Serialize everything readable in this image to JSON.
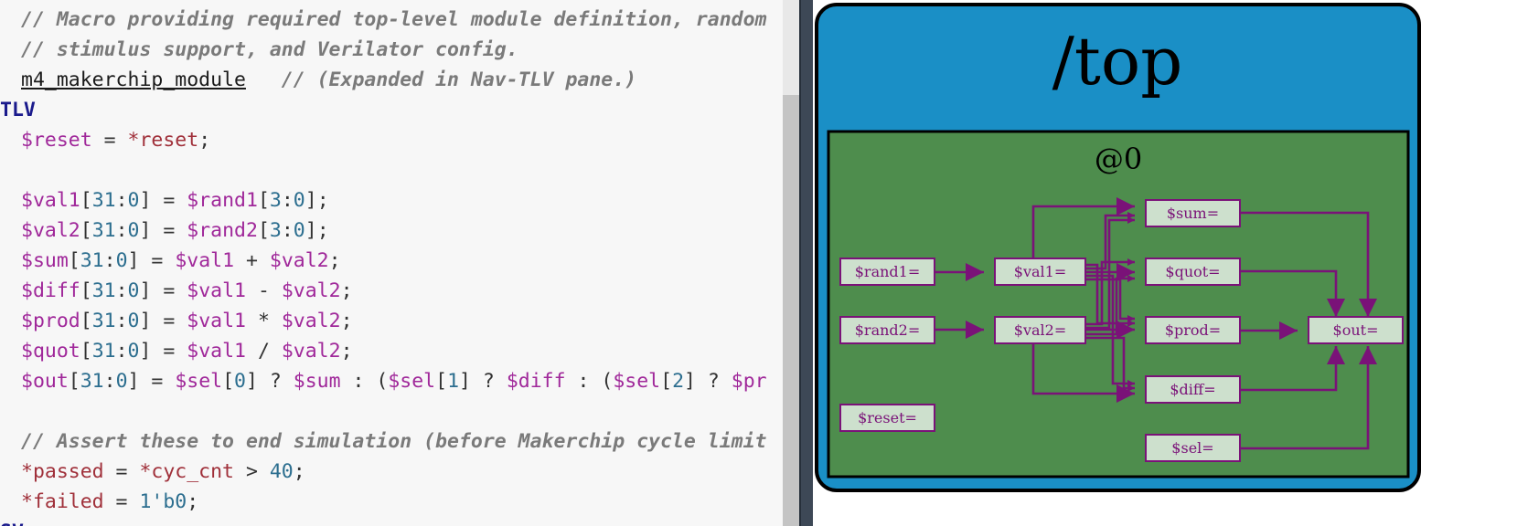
{
  "editor": {
    "lines": [
      [
        {
          "t": "// Macro providing required top-level module definition, random",
          "c": "cmt"
        }
      ],
      [
        {
          "t": "// stimulus support, and Verilator config.",
          "c": "cmt"
        }
      ],
      [
        {
          "t": "m4_makerchip_module",
          "c": "lnk"
        },
        {
          "t": "   ",
          "c": "op"
        },
        {
          "t": "// (Expanded in Nav-TLV pane.)",
          "c": "cmt"
        }
      ],
      [
        {
          "t": "\\TLV",
          "c": "kw"
        }
      ],
      [
        {
          "t": "$reset",
          "c": "sig"
        },
        {
          "t": " = ",
          "c": "op"
        },
        {
          "t": "*reset",
          "c": "tb"
        },
        {
          "t": ";",
          "c": "op"
        }
      ],
      [],
      [
        {
          "t": "$val1",
          "c": "sig"
        },
        {
          "t": "[",
          "c": "op"
        },
        {
          "t": "31",
          "c": "num"
        },
        {
          "t": ":",
          "c": "op"
        },
        {
          "t": "0",
          "c": "num"
        },
        {
          "t": "] = ",
          "c": "op"
        },
        {
          "t": "$rand1",
          "c": "sig"
        },
        {
          "t": "[",
          "c": "op"
        },
        {
          "t": "3",
          "c": "num"
        },
        {
          "t": ":",
          "c": "op"
        },
        {
          "t": "0",
          "c": "num"
        },
        {
          "t": "];",
          "c": "op"
        }
      ],
      [
        {
          "t": "$val2",
          "c": "sig"
        },
        {
          "t": "[",
          "c": "op"
        },
        {
          "t": "31",
          "c": "num"
        },
        {
          "t": ":",
          "c": "op"
        },
        {
          "t": "0",
          "c": "num"
        },
        {
          "t": "] = ",
          "c": "op"
        },
        {
          "t": "$rand2",
          "c": "sig"
        },
        {
          "t": "[",
          "c": "op"
        },
        {
          "t": "3",
          "c": "num"
        },
        {
          "t": ":",
          "c": "op"
        },
        {
          "t": "0",
          "c": "num"
        },
        {
          "t": "];",
          "c": "op"
        }
      ],
      [
        {
          "t": "$sum",
          "c": "sig"
        },
        {
          "t": "[",
          "c": "op"
        },
        {
          "t": "31",
          "c": "num"
        },
        {
          "t": ":",
          "c": "op"
        },
        {
          "t": "0",
          "c": "num"
        },
        {
          "t": "] = ",
          "c": "op"
        },
        {
          "t": "$val1",
          "c": "sig"
        },
        {
          "t": " + ",
          "c": "op"
        },
        {
          "t": "$val2",
          "c": "sig"
        },
        {
          "t": ";",
          "c": "op"
        }
      ],
      [
        {
          "t": "$diff",
          "c": "sig"
        },
        {
          "t": "[",
          "c": "op"
        },
        {
          "t": "31",
          "c": "num"
        },
        {
          "t": ":",
          "c": "op"
        },
        {
          "t": "0",
          "c": "num"
        },
        {
          "t": "] = ",
          "c": "op"
        },
        {
          "t": "$val1",
          "c": "sig"
        },
        {
          "t": " - ",
          "c": "op"
        },
        {
          "t": "$val2",
          "c": "sig"
        },
        {
          "t": ";",
          "c": "op"
        }
      ],
      [
        {
          "t": "$prod",
          "c": "sig"
        },
        {
          "t": "[",
          "c": "op"
        },
        {
          "t": "31",
          "c": "num"
        },
        {
          "t": ":",
          "c": "op"
        },
        {
          "t": "0",
          "c": "num"
        },
        {
          "t": "] = ",
          "c": "op"
        },
        {
          "t": "$val1",
          "c": "sig"
        },
        {
          "t": " * ",
          "c": "op"
        },
        {
          "t": "$val2",
          "c": "sig"
        },
        {
          "t": ";",
          "c": "op"
        }
      ],
      [
        {
          "t": "$quot",
          "c": "sig"
        },
        {
          "t": "[",
          "c": "op"
        },
        {
          "t": "31",
          "c": "num"
        },
        {
          "t": ":",
          "c": "op"
        },
        {
          "t": "0",
          "c": "num"
        },
        {
          "t": "] = ",
          "c": "op"
        },
        {
          "t": "$val1",
          "c": "sig"
        },
        {
          "t": " / ",
          "c": "op"
        },
        {
          "t": "$val2",
          "c": "sig"
        },
        {
          "t": ";",
          "c": "op"
        }
      ],
      [
        {
          "t": "$out",
          "c": "sig"
        },
        {
          "t": "[",
          "c": "op"
        },
        {
          "t": "31",
          "c": "num"
        },
        {
          "t": ":",
          "c": "op"
        },
        {
          "t": "0",
          "c": "num"
        },
        {
          "t": "] = ",
          "c": "op"
        },
        {
          "t": "$sel",
          "c": "sig"
        },
        {
          "t": "[",
          "c": "op"
        },
        {
          "t": "0",
          "c": "num"
        },
        {
          "t": "] ? ",
          "c": "op"
        },
        {
          "t": "$sum",
          "c": "sig"
        },
        {
          "t": " : (",
          "c": "op"
        },
        {
          "t": "$sel",
          "c": "sig"
        },
        {
          "t": "[",
          "c": "op"
        },
        {
          "t": "1",
          "c": "num"
        },
        {
          "t": "] ? ",
          "c": "op"
        },
        {
          "t": "$diff",
          "c": "sig"
        },
        {
          "t": " : (",
          "c": "op"
        },
        {
          "t": "$sel",
          "c": "sig"
        },
        {
          "t": "[",
          "c": "op"
        },
        {
          "t": "2",
          "c": "num"
        },
        {
          "t": "] ? ",
          "c": "op"
        },
        {
          "t": "$pr",
          "c": "sig"
        }
      ],
      [],
      [
        {
          "t": "// Assert these to end simulation (before Makerchip cycle limit",
          "c": "cmt"
        }
      ],
      [
        {
          "t": "*passed",
          "c": "tb"
        },
        {
          "t": " = ",
          "c": "op"
        },
        {
          "t": "*cyc_cnt",
          "c": "tb"
        },
        {
          "t": " > ",
          "c": "op"
        },
        {
          "t": "40",
          "c": "num"
        },
        {
          "t": ";",
          "c": "op"
        }
      ],
      [
        {
          "t": "*failed",
          "c": "tb"
        },
        {
          "t": " = ",
          "c": "op"
        },
        {
          "t": "1'b0",
          "c": "num"
        },
        {
          "t": ";",
          "c": "op"
        }
      ],
      [
        {
          "t": "\\SV",
          "c": "kw"
        }
      ]
    ]
  },
  "diagram": {
    "scope_title": "/top",
    "stage_label": "@0",
    "nodes": {
      "rand1": "$rand1=",
      "rand2": "$rand2=",
      "reset": "$reset=",
      "val1": "$val1=",
      "val2": "$val2=",
      "sum": "$sum=",
      "quot": "$quot=",
      "prod": "$prod=",
      "diff": "$diff=",
      "sel": "$sel=",
      "out": "$out="
    }
  },
  "colors": {
    "scope_fill": "#1a8fc6",
    "stage_fill": "#4e8d4d",
    "node_fill": "#cde0cd",
    "edge": "#7a1278"
  }
}
